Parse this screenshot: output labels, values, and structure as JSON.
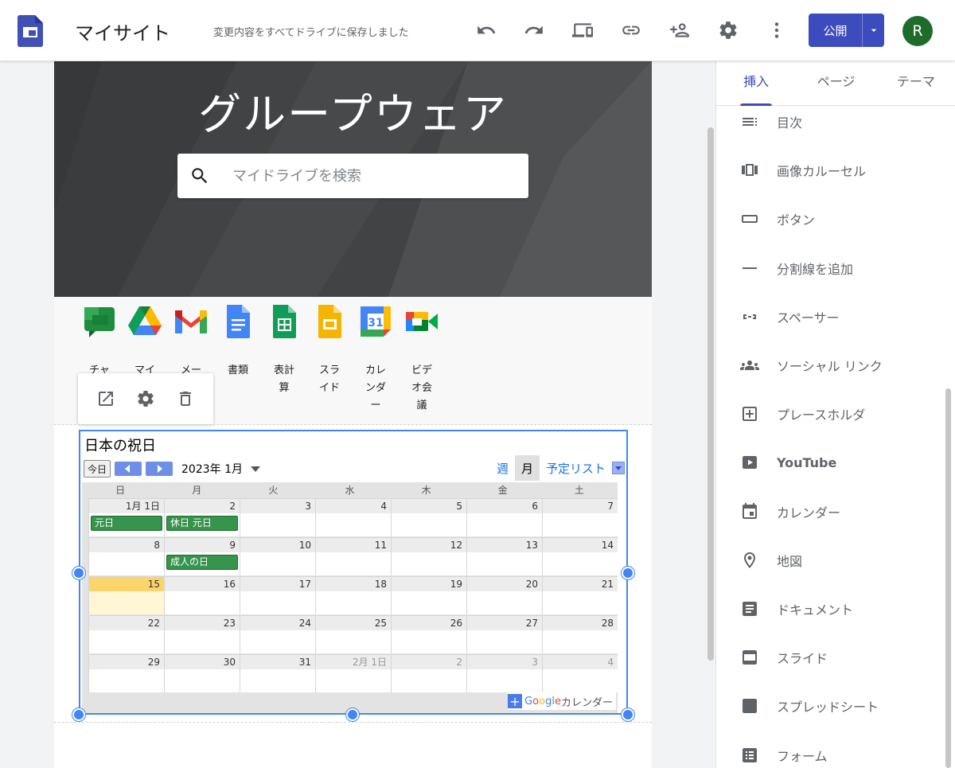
{
  "header": {
    "site_title": "マイサイト",
    "save_status": "変更内容をすべてドライブに保存しました",
    "publish_label": "公開",
    "avatar_initial": "R",
    "icons": [
      "undo-icon",
      "redo-icon",
      "preview-devices-icon",
      "link-icon",
      "share-add-person-icon",
      "settings-gear-icon",
      "more-vert-icon"
    ]
  },
  "hero": {
    "title": "グループウェア",
    "search_placeholder": "マイドライブを検索"
  },
  "apps": [
    {
      "label": "チャ",
      "icon": "google-chat-icon"
    },
    {
      "label": "マイ",
      "icon": "google-drive-icon"
    },
    {
      "label": "メー",
      "icon": "gmail-icon"
    },
    {
      "label": "書類",
      "icon": "google-docs-icon"
    },
    {
      "label": "表計算",
      "icon": "google-sheets-icon"
    },
    {
      "label": "スライド",
      "icon": "google-slides-icon"
    },
    {
      "label": "カレンダー",
      "icon": "google-calendar-icon"
    },
    {
      "label": "ビデオ会議",
      "icon": "google-meet-icon"
    }
  ],
  "float_tools": [
    "open-in-new-icon",
    "gear-icon",
    "trash-icon"
  ],
  "calendar": {
    "title": "日本の祝日",
    "today_label": "今日",
    "month_label": "2023年 1月",
    "views": {
      "week": "週",
      "month": "月",
      "agenda": "予定リスト"
    },
    "weekdays": [
      "日",
      "月",
      "火",
      "水",
      "木",
      "金",
      "土"
    ],
    "weeks": [
      {
        "days": [
          "1月 1日",
          "2",
          "3",
          "4",
          "5",
          "6",
          "7"
        ],
        "events": [
          {
            "col": 0,
            "text": "元日"
          },
          {
            "col": 1,
            "text": "休日 元日"
          }
        ]
      },
      {
        "days": [
          "8",
          "9",
          "10",
          "11",
          "12",
          "13",
          "14"
        ],
        "events": [
          {
            "col": 1,
            "text": "成人の日"
          }
        ]
      },
      {
        "days": [
          "15",
          "16",
          "17",
          "18",
          "19",
          "20",
          "21"
        ],
        "events": [],
        "today_col": 0
      },
      {
        "days": [
          "22",
          "23",
          "24",
          "25",
          "26",
          "27",
          "28"
        ],
        "events": []
      },
      {
        "days": [
          "29",
          "30",
          "31",
          "2月 1日",
          "2",
          "3",
          "4"
        ],
        "events": [],
        "other_from": 3
      }
    ],
    "badge_google": "Google",
    "badge_text": "カレンダー"
  },
  "panel": {
    "tabs": [
      "挿入",
      "ページ",
      "テーマ"
    ],
    "active_tab": "挿入",
    "items": [
      {
        "label": "目次",
        "icon": "table-of-contents-icon"
      },
      {
        "label": "画像カルーセル",
        "icon": "image-carousel-icon"
      },
      {
        "label": "ボタン",
        "icon": "button-icon"
      },
      {
        "label": "分割線を追加",
        "icon": "divider-icon"
      },
      {
        "label": "スペーサー",
        "icon": "spacer-icon"
      },
      {
        "label": "ソーシャル リンク",
        "icon": "social-people-icon"
      },
      {
        "label": "プレースホルダ",
        "icon": "placeholder-add-icon"
      },
      {
        "label": "YouTube",
        "icon": "youtube-icon"
      },
      {
        "label": "カレンダー",
        "icon": "calendar-icon"
      },
      {
        "label": "地図",
        "icon": "map-pin-icon"
      },
      {
        "label": "ドキュメント",
        "icon": "document-icon"
      },
      {
        "label": "スライド",
        "icon": "slides-icon"
      },
      {
        "label": "スプレッドシート",
        "icon": "spreadsheet-icon"
      },
      {
        "label": "フォーム",
        "icon": "form-icon"
      }
    ]
  },
  "colors": {
    "accent": "#3c4bbd",
    "selection": "#4285f4",
    "event_green": "#36944d",
    "today_yellow": "#fbd56b"
  }
}
